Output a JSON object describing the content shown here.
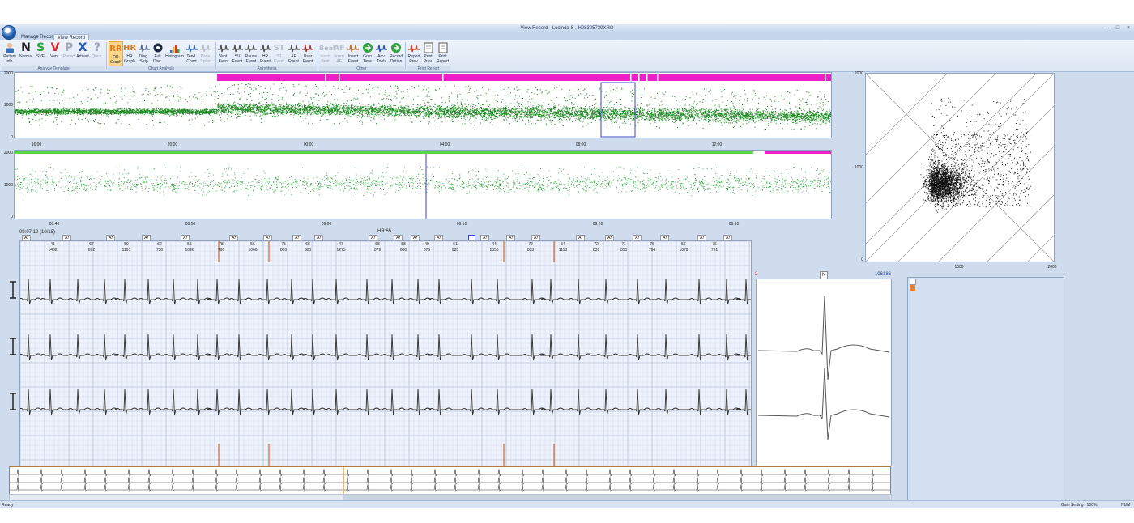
{
  "window": {
    "title": "View Record  -  Lucinda S , H98305739XRQ"
  },
  "tabs": [
    "Manage Record",
    "View Record"
  ],
  "ribbon": {
    "buttons": [
      {
        "l1": "Patient",
        "l2": "Info.",
        "icon": "patient-info-icon"
      },
      {
        "l1": "Normal",
        "l2": "",
        "letter": "N",
        "color": "#1a1a1a"
      },
      {
        "l1": "SVE",
        "l2": "",
        "letter": "S",
        "color": "#2fa33c"
      },
      {
        "l1": "Vent.",
        "l2": "",
        "letter": "V",
        "color": "#d8282e"
      },
      {
        "l1": "Paced",
        "l2": "",
        "letter": "P",
        "color": "#9aa6b6"
      },
      {
        "l1": "Artifact",
        "l2": "",
        "letter": "X",
        "color": "#2356b8"
      },
      {
        "l1": "Ques.",
        "l2": "",
        "letter": "?",
        "color": "#9aa6b6"
      },
      {
        "l1": "RR",
        "l2": "Graph",
        "letter": "RR",
        "color": "#e07a1f"
      },
      {
        "l1": "HR",
        "l2": "Graph",
        "letter": "HR",
        "color": "#e07a1f"
      },
      {
        "l1": "Diag.",
        "l2": "Strip",
        "icon": "strip-icon"
      },
      {
        "l1": "Full",
        "l2": "Disc.",
        "icon": "disc-icon"
      },
      {
        "l1": "Histogram",
        "l2": "",
        "icon": "histogram-icon"
      },
      {
        "l1": "Tend.",
        "l2": "Chart",
        "icon": "trend-icon"
      },
      {
        "l1": "Pace",
        "l2": "Spike",
        "icon": "pace-spike-icon"
      },
      {
        "l1": "Vent.",
        "l2": "Event",
        "icon": "vent-event-icon"
      },
      {
        "l1": "SV",
        "l2": "Event",
        "icon": "sv-event-icon"
      },
      {
        "l1": "Pause",
        "l2": "Event",
        "icon": "pause-event-icon"
      },
      {
        "l1": "HR",
        "l2": "Event",
        "icon": "hr-event-icon"
      },
      {
        "l1": "ST",
        "l2": "Event",
        "letter": "ST",
        "color": "#b7c0cc"
      },
      {
        "l1": "AF",
        "l2": "Event",
        "icon": "af-event-icon"
      },
      {
        "l1": "User",
        "l2": "Event",
        "icon": "user-event-icon"
      },
      {
        "l1": "Insert",
        "l2": "Beat",
        "letter": "Beat",
        "color": "#b7c0cc"
      },
      {
        "l1": "Insert",
        "l2": "AF",
        "letter": "AF",
        "color": "#b7c0cc"
      },
      {
        "l1": "Insert",
        "l2": "Event",
        "icon": "insert-event-icon"
      },
      {
        "l1": "Goto",
        "l2": "Time",
        "icon": "goto-time-icon"
      },
      {
        "l1": "Adv.",
        "l2": "Tools",
        "icon": "adv-tools-icon"
      },
      {
        "l1": "Record",
        "l2": "Option",
        "icon": "record-option-icon"
      },
      {
        "l1": "Report",
        "l2": "Prev.",
        "icon": "report-prev-icon"
      },
      {
        "l1": "Print",
        "l2": "Prev.",
        "icon": "print-prev-icon"
      },
      {
        "l1": "Print",
        "l2": "Report",
        "icon": "print-report-icon"
      }
    ],
    "groups": [
      "Analyze Template",
      "Chart Analysis",
      "Arrhythmia",
      "Other",
      "Print Report"
    ]
  },
  "rr_trend_chart": {
    "type": "scatter",
    "y_ticks": [
      "2000",
      "1000",
      "0"
    ],
    "x_ticks": [
      "16:00",
      "20:00",
      "00:00",
      "04:00",
      "08:00",
      "12:00"
    ]
  },
  "rr_detail_chart": {
    "type": "scatter",
    "y_ticks": [
      "2000",
      "1000",
      "0"
    ],
    "x_ticks": [
      "08:40",
      "08:50",
      "09:00",
      "09:10",
      "09:20",
      "09:30"
    ]
  },
  "poincare_chart": {
    "type": "scatter",
    "y_ticks": [
      "2000",
      "1000",
      "0"
    ],
    "x_ticks": [
      "1000",
      "2000"
    ]
  },
  "strip": {
    "time_label": "09:07:10 (10/18)",
    "hr_label": "HR:65",
    "af_tag": "Af",
    "top_row": [
      "41",
      "67",
      "50",
      "62",
      "55",
      "78",
      "56",
      "75",
      "68",
      "47",
      "68",
      "88",
      "49",
      "61",
      "44",
      "72",
      "54",
      "72",
      "71",
      "76",
      "56",
      "76"
    ],
    "bottom_row": [
      "1462",
      "892",
      "1191",
      "730",
      "1096",
      "780",
      "1066",
      "803",
      "680",
      "1275",
      "879",
      "680",
      "675",
      "985",
      "1356",
      "833",
      "1118",
      "839",
      "850",
      "794",
      "1079",
      "791"
    ]
  },
  "template_panel": {
    "count_label": "2",
    "beat_type": "N",
    "beat_count": "106186"
  },
  "status": {
    "left": "Ready",
    "gain": "Gain Setting : 100%",
    "num": "NUM"
  },
  "colors": {
    "trend_green": "#1e8a22",
    "af_magenta": "#ee1ec8",
    "normal_bar": "#5ad646",
    "marker_orange": "#e86a2c",
    "cursor_blue": "#3a44c8",
    "grid_blue": "#d4def0"
  }
}
